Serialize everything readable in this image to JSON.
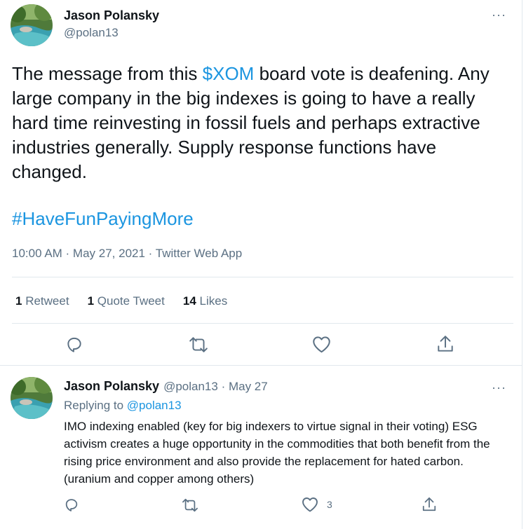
{
  "tweet": {
    "author_name": "Jason Polansky",
    "author_handle": "@polan13",
    "text_before": "The message from this ",
    "cashtag": "$XOM",
    "text_after": " board vote is deafening. Any large company in the big indexes is going to have a really hard time reinvesting in fossil fuels and perhaps extractive industries generally. Supply response functions have changed.",
    "hashtag": "#HaveFunPayingMore",
    "meta": "10:00 AM · May 27, 2021 · Twitter Web App",
    "more_icon": "···",
    "stats": {
      "retweets_count": "1",
      "retweets_label": "Retweet",
      "quotes_count": "1",
      "quotes_label": "Quote Tweet",
      "likes_count": "14",
      "likes_label": "Likes"
    }
  },
  "reply": {
    "author_name": "Jason Polansky",
    "author_handle_date": "@polan13 · May 27",
    "replying_prefix": "Replying to ",
    "replying_handle": "@polan13",
    "text": "IMO indexing enabled (key for big indexers to virtue signal in their voting) ESG activism creates a huge opportunity in the commodities that both benefit from the rising price environment and also provide the replacement for hated carbon. (uranium and copper among others)",
    "like_count": "3",
    "more_icon": "···"
  },
  "icons": [
    "reply-icon",
    "retweet-icon",
    "like-icon",
    "share-icon",
    "more-icon"
  ],
  "colors": {
    "link": "#1b95e0",
    "secondary_text": "#5b7083",
    "primary_text": "#0f1419",
    "divider": "#e1e8ed"
  }
}
